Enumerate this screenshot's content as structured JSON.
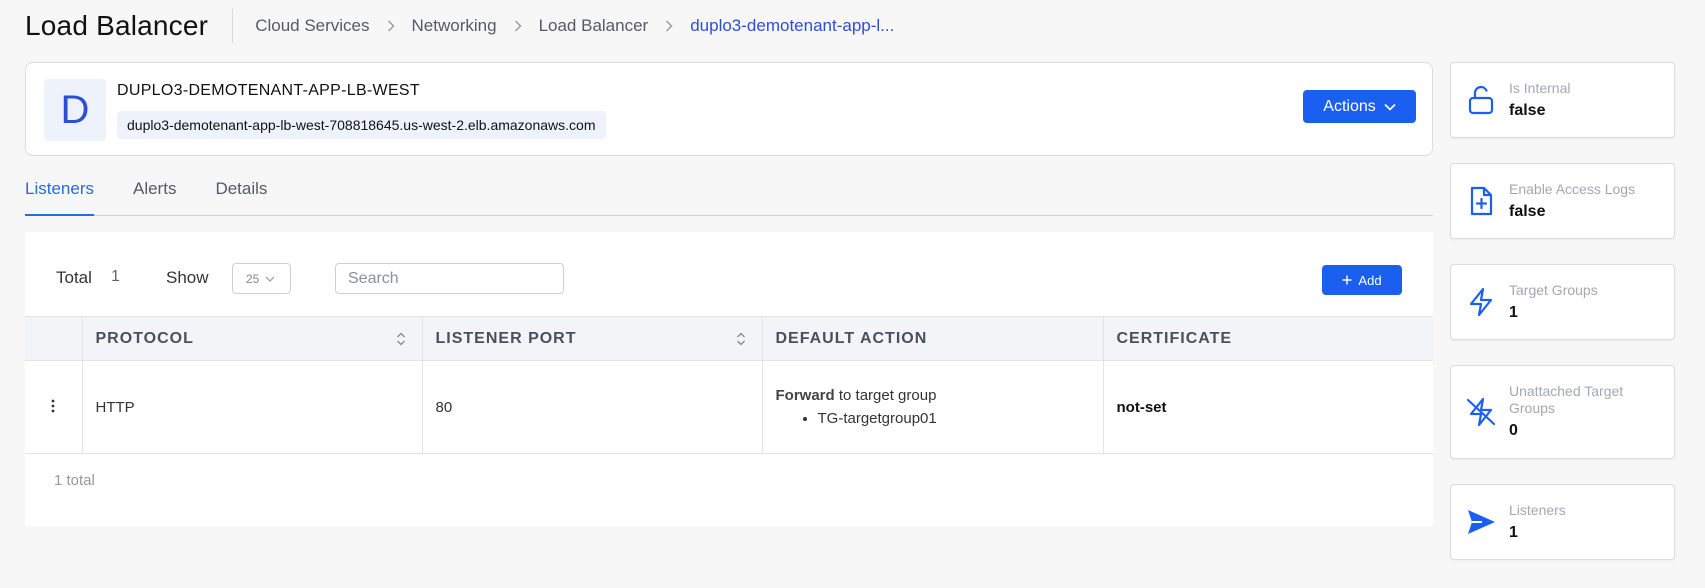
{
  "header": {
    "title": "Load Balancer",
    "breadcrumb": [
      "Cloud Services",
      "Networking",
      "Load Balancer",
      "duplo3-demotenant-app-l..."
    ]
  },
  "lb": {
    "avatar_letter": "D",
    "name": "DUPLO3-DEMOTENANT-APP-LB-WEST",
    "dns": "duplo3-demotenant-app-lb-west-708818645.us-west-2.elb.amazonaws.com",
    "actions_label": "Actions"
  },
  "tabs": [
    {
      "label": "Listeners",
      "active": true
    },
    {
      "label": "Alerts",
      "active": false
    },
    {
      "label": "Details",
      "active": false
    }
  ],
  "toolbar": {
    "total_label": "Total",
    "total_value": "1",
    "show_label": "Show",
    "show_value": "25",
    "search_placeholder": "Search",
    "add_label": "Add"
  },
  "table": {
    "columns": [
      "PROTOCOL",
      "LISTENER PORT",
      "DEFAULT ACTION",
      "CERTIFICATE"
    ],
    "rows": [
      {
        "protocol": "HTTP",
        "port": "80",
        "action_strong": "Forward",
        "action_rest": " to target group",
        "action_targets": [
          "TG-targetgroup01"
        ],
        "certificate": "not-set"
      }
    ],
    "footer": "1 total"
  },
  "stats": [
    {
      "label": "Is Internal",
      "value": "false",
      "icon": "unlock-icon"
    },
    {
      "label": "Enable Access Logs",
      "value": "false",
      "icon": "file-plus-icon"
    },
    {
      "label": "Target Groups",
      "value": "1",
      "icon": "zap-icon"
    },
    {
      "label": "Unattached Target Groups",
      "value": "0",
      "icon": "zap-off-icon"
    },
    {
      "label": "Listeners",
      "value": "1",
      "icon": "send-icon"
    }
  ],
  "colors": {
    "accent": "#1a5ff0",
    "link": "#2b50d6"
  }
}
